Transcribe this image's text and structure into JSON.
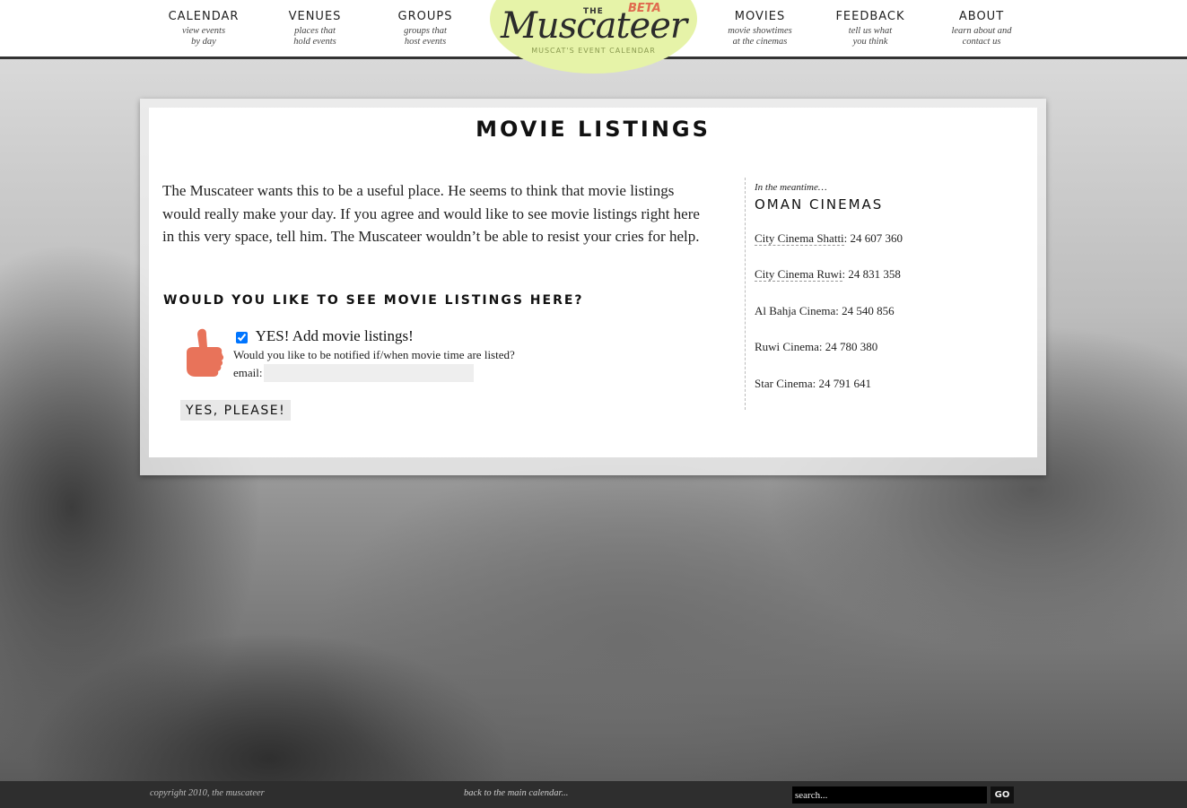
{
  "nav": {
    "left": [
      {
        "label": "CALENDAR",
        "sub1": "view events",
        "sub2": "by day"
      },
      {
        "label": "VENUES",
        "sub1": "places that",
        "sub2": "hold events"
      },
      {
        "label": "GROUPS",
        "sub1": "groups that",
        "sub2": "host events"
      }
    ],
    "right": [
      {
        "label": "MOVIES",
        "sub1": "movie showtimes",
        "sub2": "at the cinemas"
      },
      {
        "label": "FEEDBACK",
        "sub1": "tell us what",
        "sub2": "you think"
      },
      {
        "label": "ABOUT",
        "sub1": "learn about and",
        "sub2": "contact us"
      }
    ]
  },
  "logo": {
    "the": "THE",
    "name": "Muscateer",
    "beta": "BETA",
    "tagline": "MUSCAT'S EVENT CALENDAR",
    "color": "#e6f3a8"
  },
  "main": {
    "title": "Movie Listings",
    "intro": "The Muscateer wants this to be a useful place. He seems to think that movie listings would really make your day. If you agree and would like to see movie listings right here in this very space, tell him. The Muscateer wouldn’t be able to resist your cries for help.",
    "question": "Would you like to see movie listings here?",
    "option_label": "YES! Add movie listings!",
    "option_checked": true,
    "notify_text": "Would you like to be notified if/when movie time are listed?",
    "email_label": "email:",
    "email_value": "",
    "submit_label": "Yes, please!",
    "thumb_icon": "thumbs-up-icon",
    "thumb_color": "#e8735a"
  },
  "sidebar": {
    "intro": "In the meantime…",
    "title": "Oman Cinemas",
    "cinemas": [
      {
        "name": "City Cinema Shatti",
        "phone": ": 24 607 360",
        "linked": true
      },
      {
        "name": "City Cinema Ruwi",
        "phone": ": 24 831 358",
        "linked": true
      },
      {
        "name": "Al Bahja Cinema",
        "phone": ": 24 540 856",
        "linked": false
      },
      {
        "name": "Ruwi Cinema",
        "phone": ": 24 780 380",
        "linked": false
      },
      {
        "name": "Star Cinema",
        "phone": ": 24 791 641",
        "linked": false
      }
    ]
  },
  "footer": {
    "copyright": "copyright 2010, the muscateer",
    "back_link": "back to the main calendar...",
    "search_value": "search...",
    "go_label": "GO"
  }
}
